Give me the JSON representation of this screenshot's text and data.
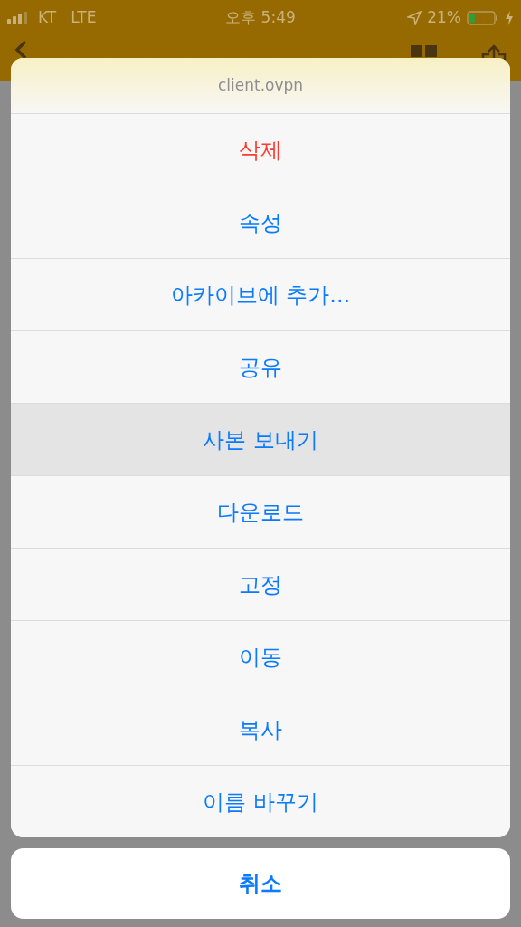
{
  "status_bar": {
    "carrier": "KT",
    "network": "LTE",
    "time": "오후 5:49",
    "battery": "21%"
  },
  "action_sheet": {
    "title": "client.ovpn",
    "actions": [
      {
        "label": "삭제",
        "kind": "destructive",
        "selected": false
      },
      {
        "label": "속성",
        "kind": "default",
        "selected": false
      },
      {
        "label": "아카이브에 추가...",
        "kind": "default",
        "selected": false
      },
      {
        "label": "공유",
        "kind": "default",
        "selected": false
      },
      {
        "label": "사본 보내기",
        "kind": "default",
        "selected": true
      },
      {
        "label": "다운로드",
        "kind": "default",
        "selected": false
      },
      {
        "label": "고정",
        "kind": "default",
        "selected": false
      },
      {
        "label": "이동",
        "kind": "default",
        "selected": false
      },
      {
        "label": "복사",
        "kind": "default",
        "selected": false
      },
      {
        "label": "이름 바꾸기",
        "kind": "default",
        "selected": false
      }
    ],
    "cancel": "취소"
  }
}
